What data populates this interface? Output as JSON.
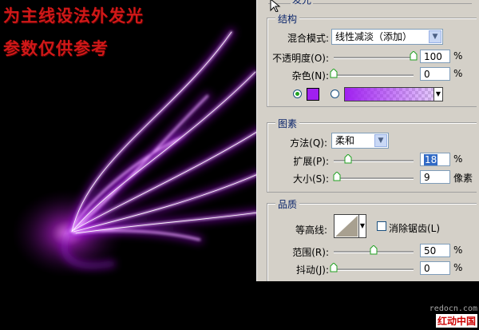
{
  "captions": {
    "line1": "为主线设法外发光",
    "line2": "参数仅供参考"
  },
  "panel": {
    "header_partial": "发光",
    "structure": {
      "title": "结构",
      "blend_mode": {
        "label": "混合模式:",
        "value": "线性减淡（添加）"
      },
      "opacity": {
        "label": "不透明度(O):",
        "value": "100",
        "unit": "%",
        "level_percent": 100
      },
      "noise": {
        "label": "杂色(N):",
        "value": "0",
        "unit": "%",
        "level_percent": 0
      },
      "color_swatch": "#a020f0",
      "gradient_from": "#a020f0"
    },
    "elements": {
      "title": "图素",
      "method": {
        "label": "方法(Q):",
        "value": "柔和"
      },
      "spread": {
        "label": "扩展(P):",
        "value": "18",
        "unit": "%",
        "level_percent": 18
      },
      "size": {
        "label": "大小(S):",
        "value": "9",
        "unit": "像素",
        "level_percent": 4
      }
    },
    "quality": {
      "title": "品质",
      "contour": {
        "label": "等高线:"
      },
      "anti_alias": {
        "label": "消除锯齿(L)",
        "checked": false
      },
      "range": {
        "label": "范围(R):",
        "value": "50",
        "unit": "%",
        "level_percent": 50
      },
      "jitter": {
        "label": "抖动(J):",
        "value": "0",
        "unit": "%",
        "level_percent": 0
      }
    }
  },
  "watermark": {
    "line1": "redocn.com",
    "line2": "红动中国"
  },
  "colors": {
    "glow": "#c040ff",
    "caption": "#d01818",
    "panel_bg": "#d4d0c8",
    "group_title": "#0a246a"
  }
}
